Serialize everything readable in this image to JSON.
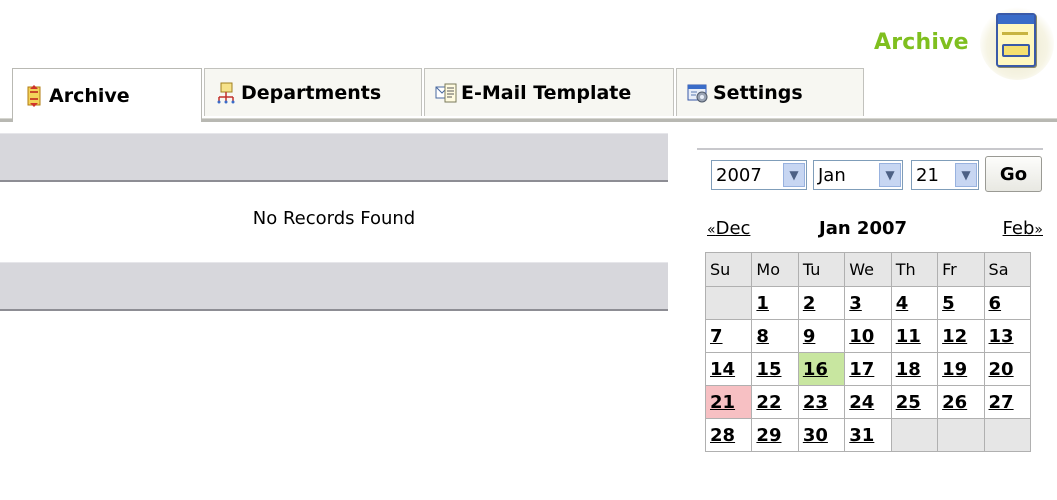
{
  "header": {
    "title": "Archive",
    "icon": "archive-icon"
  },
  "tabs": [
    {
      "label": "Archive",
      "icon": "archive-tab-icon",
      "active": true
    },
    {
      "label": "Departments",
      "icon": "departments-icon",
      "active": false
    },
    {
      "label": "E-Mail Template",
      "icon": "email-template-icon",
      "active": false
    },
    {
      "label": "Settings",
      "icon": "settings-icon",
      "active": false
    }
  ],
  "main": {
    "empty_message": "No Records Found"
  },
  "calendar": {
    "year": "2007",
    "month": "Jan",
    "day": "21",
    "go_label": "Go",
    "prev_label": "Dec",
    "prev_arrow": "«",
    "current_label": "Jan 2007",
    "next_label": "Feb",
    "next_arrow": "»",
    "weekdays": [
      "Su",
      "Mo",
      "Tu",
      "We",
      "Th",
      "Fr",
      "Sa"
    ],
    "weeks": [
      [
        "",
        "1",
        "2",
        "3",
        "4",
        "5",
        "6"
      ],
      [
        "7",
        "8",
        "9",
        "10",
        "11",
        "12",
        "13"
      ],
      [
        "14",
        "15",
        "16",
        "17",
        "18",
        "19",
        "20"
      ],
      [
        "21",
        "22",
        "23",
        "24",
        "25",
        "26",
        "27"
      ],
      [
        "28",
        "29",
        "30",
        "31",
        "",
        "",
        ""
      ]
    ],
    "today": "16",
    "selected": "21",
    "colors": {
      "today": "#c8e6a0",
      "selected": "#f7c0c3"
    }
  }
}
